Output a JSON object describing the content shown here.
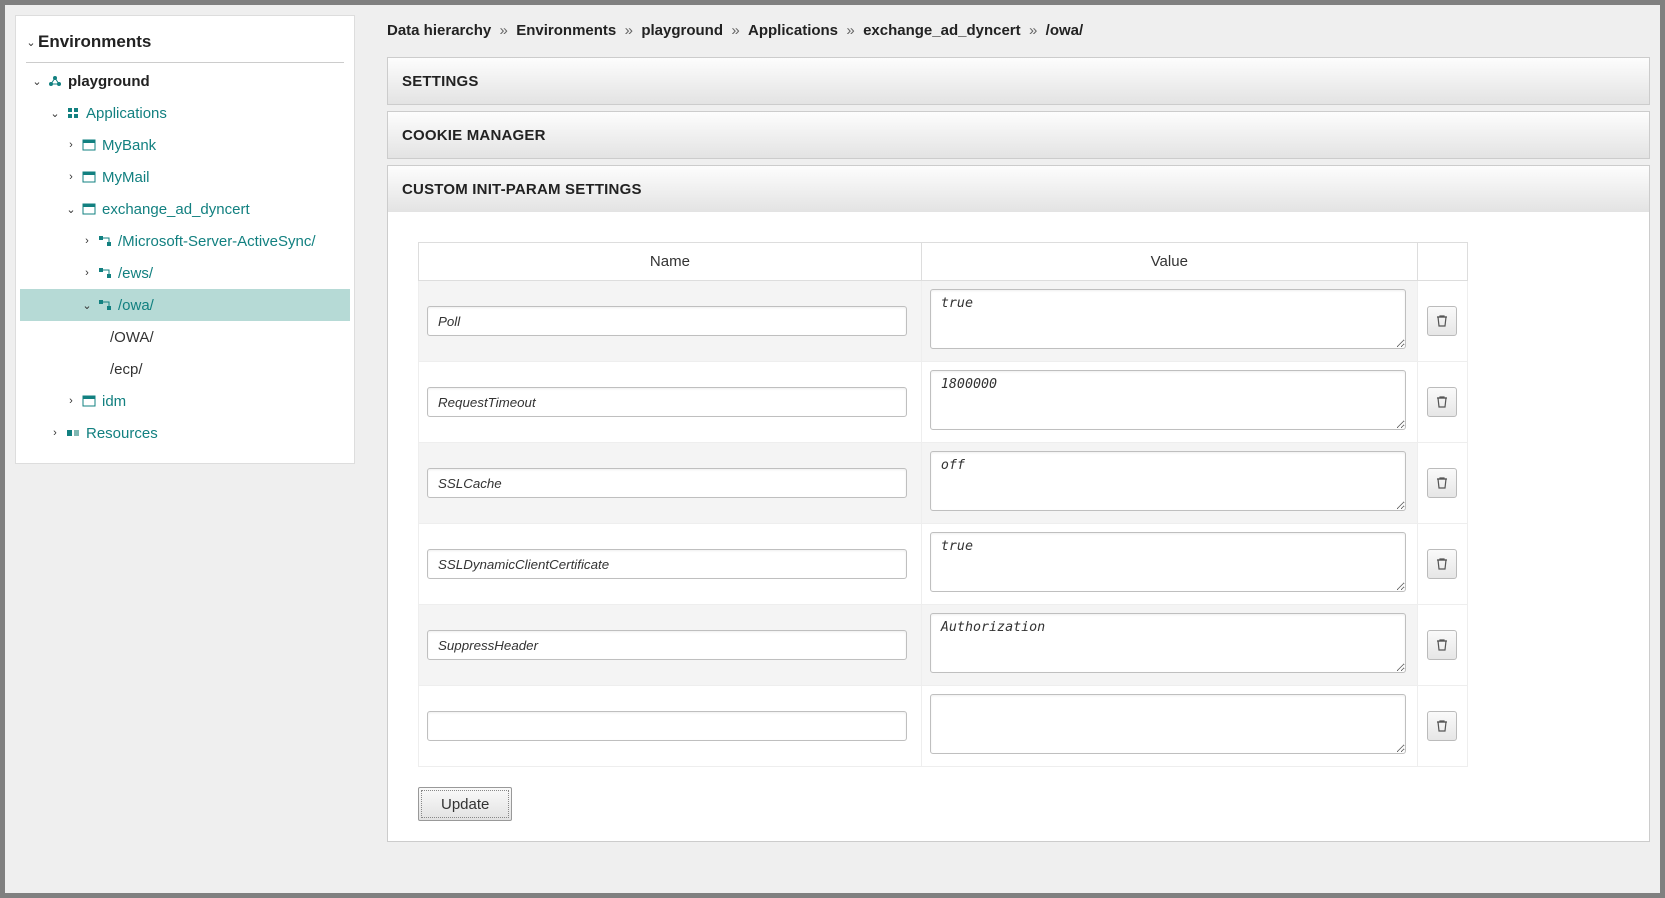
{
  "sidebar": {
    "title": "Environments",
    "root": {
      "label": "playground"
    },
    "applications_label": "Applications",
    "apps": [
      {
        "label": "MyBank"
      },
      {
        "label": "MyMail"
      },
      {
        "label": "exchange_ad_dyncert",
        "routes": [
          {
            "label": "/Microsoft-Server-ActiveSync/"
          },
          {
            "label": "/ews/"
          },
          {
            "label": "/owa/",
            "selected": true,
            "children": [
              {
                "label": "/OWA/"
              },
              {
                "label": "/ecp/"
              }
            ]
          }
        ]
      },
      {
        "label": "idm"
      }
    ],
    "resources_label": "Resources"
  },
  "breadcrumb": [
    "Data hierarchy",
    "Environments",
    "playground",
    "Applications",
    "exchange_ad_dyncert",
    "/owa/"
  ],
  "panels": {
    "settings": "SETTINGS",
    "cookie": "COOKIE MANAGER",
    "custom": "CUSTOM INIT-PARAM SETTINGS"
  },
  "table": {
    "headers": {
      "name": "Name",
      "value": "Value"
    },
    "rows": [
      {
        "name": "Poll",
        "value": "true"
      },
      {
        "name": "RequestTimeout",
        "value": "1800000"
      },
      {
        "name": "SSLCache",
        "value": "off"
      },
      {
        "name": "SSLDynamicClientCertificate",
        "value": "true"
      },
      {
        "name": "SuppressHeader",
        "value": "Authorization"
      },
      {
        "name": "",
        "value": ""
      }
    ]
  },
  "buttons": {
    "update": "Update"
  }
}
